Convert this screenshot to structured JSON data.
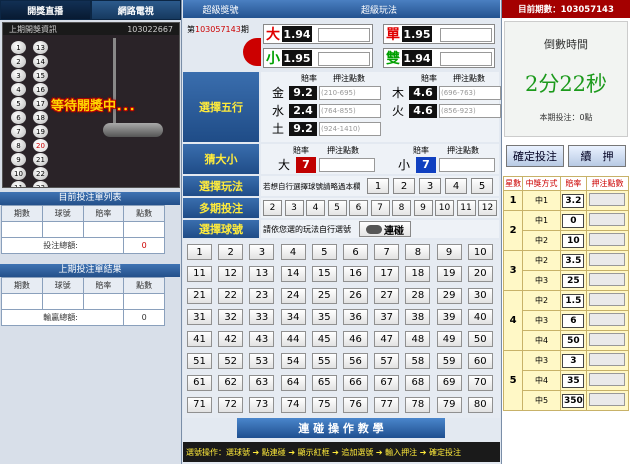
{
  "left": {
    "tabs": [
      "開獎直播",
      "網路電視"
    ],
    "video": {
      "last_result_label": "上期開獎資訊",
      "period": "103022667",
      "waiting": "等待開獎中．．．",
      "col1": [
        "1",
        "2",
        "3",
        "4",
        "5",
        "6",
        "7",
        "8",
        "9",
        "10",
        "11",
        "12"
      ],
      "col2": [
        "13",
        "14",
        "15",
        "16",
        "17",
        "18",
        "19",
        "20",
        "21",
        "22",
        "23",
        "24"
      ],
      "highlight": [
        "20"
      ]
    },
    "current_list": {
      "title": "目前投注單列表",
      "headers": [
        "期數",
        "球號",
        "賠率",
        "點數"
      ],
      "total_label": "投注總額:",
      "total_value": "0"
    },
    "last_list": {
      "title": "上期投注單結果",
      "headers": [
        "期數",
        "球號",
        "賠率",
        "點數"
      ],
      "total_label": "輸贏總額:",
      "total_value": "0"
    }
  },
  "center": {
    "header": {
      "left": "超級獎號",
      "right": "超級玩法"
    },
    "draw_prefix": "第",
    "draw_period": "103057143",
    "draw_suffix": "期",
    "big_small_odd_even": [
      {
        "label": "大",
        "odds": "1.94",
        "color": "#e00000"
      },
      {
        "label": "單",
        "odds": "1.95",
        "color": "#e00000"
      },
      {
        "label": "小",
        "odds": "1.95",
        "color": "#00a000"
      },
      {
        "label": "雙",
        "odds": "1.94",
        "color": "#00a000"
      }
    ],
    "five_elements": {
      "label": "選擇五行",
      "col_headers": [
        "賠率",
        "押注點數"
      ],
      "items": [
        {
          "label": "金",
          "odds": "9.2",
          "range": "(210-695)"
        },
        {
          "label": "木",
          "odds": "4.6",
          "range": "(696-763)"
        },
        {
          "label": "水",
          "odds": "2.4",
          "range": "(764-855)"
        },
        {
          "label": "火",
          "odds": "4.6",
          "range": "(856-923)"
        },
        {
          "label": "土",
          "odds": "9.2",
          "range": "(924-1410)"
        }
      ]
    },
    "guess": {
      "label": "猜大小",
      "items": [
        {
          "label": "大",
          "odds": "7",
          "color": "#c00000"
        },
        {
          "label": "小",
          "odds": "7",
          "color": "#1040c0"
        }
      ]
    },
    "play_mode": {
      "label": "選擇玩法",
      "hint": "若想自行選擇球號請略過本欄",
      "options": [
        "1",
        "2",
        "3",
        "4",
        "5"
      ]
    },
    "multi": {
      "label": "多期投注",
      "options": [
        "2",
        "3",
        "4",
        "5",
        "6",
        "7",
        "8",
        "9",
        "10",
        "11",
        "12"
      ]
    },
    "pick": {
      "label": "選擇球號",
      "hint": "請依您選的玩法自行選號",
      "toggle_label": "連碰"
    },
    "numbers": [
      "1",
      "2",
      "3",
      "4",
      "5",
      "6",
      "7",
      "8",
      "9",
      "10",
      "11",
      "12",
      "13",
      "14",
      "15",
      "16",
      "17",
      "18",
      "19",
      "20",
      "21",
      "22",
      "23",
      "24",
      "25",
      "26",
      "27",
      "28",
      "29",
      "30",
      "31",
      "32",
      "33",
      "34",
      "35",
      "36",
      "37",
      "38",
      "39",
      "40",
      "41",
      "42",
      "43",
      "44",
      "45",
      "46",
      "47",
      "48",
      "49",
      "50",
      "51",
      "52",
      "53",
      "54",
      "55",
      "56",
      "57",
      "58",
      "59",
      "60",
      "61",
      "62",
      "63",
      "64",
      "65",
      "66",
      "67",
      "68",
      "69",
      "70",
      "71",
      "72",
      "73",
      "74",
      "75",
      "76",
      "77",
      "78",
      "79",
      "80"
    ],
    "tutorial_button": "連 碰 操 作 教 學",
    "ops_text": "選號操作：選球號 ➔ 點連碰 ➔ 顯示紅框 ➔ 追加選號 ➔ 輸入押注 ➔ 確定投注"
  },
  "right": {
    "period_label": "目前期數：103057143",
    "countdown_label": "倒數時間",
    "countdown_value": "2分22秒",
    "bet_label": "本期投注：0點",
    "confirm_button": "確定投注",
    "continue_button": "續　押",
    "table_headers": [
      "星數",
      "中獎方式",
      "賠率",
      "押注點數"
    ],
    "rows": [
      {
        "star": "1",
        "way": "中1",
        "odds": "3.2"
      },
      {
        "star": "2",
        "way": "中1",
        "odds": "0"
      },
      {
        "star": "",
        "way": "中2",
        "odds": "10"
      },
      {
        "star": "3",
        "way": "中2",
        "odds": "3.5"
      },
      {
        "star": "",
        "way": "中3",
        "odds": "25"
      },
      {
        "star": "4",
        "way": "中2",
        "odds": "1.5"
      },
      {
        "star": "",
        "way": "中3",
        "odds": "6"
      },
      {
        "star": "",
        "way": "中4",
        "odds": "50"
      },
      {
        "star": "5",
        "way": "中3",
        "odds": "3"
      },
      {
        "star": "",
        "way": "中4",
        "odds": "35"
      },
      {
        "star": "",
        "way": "中5",
        "odds": "350"
      }
    ]
  }
}
